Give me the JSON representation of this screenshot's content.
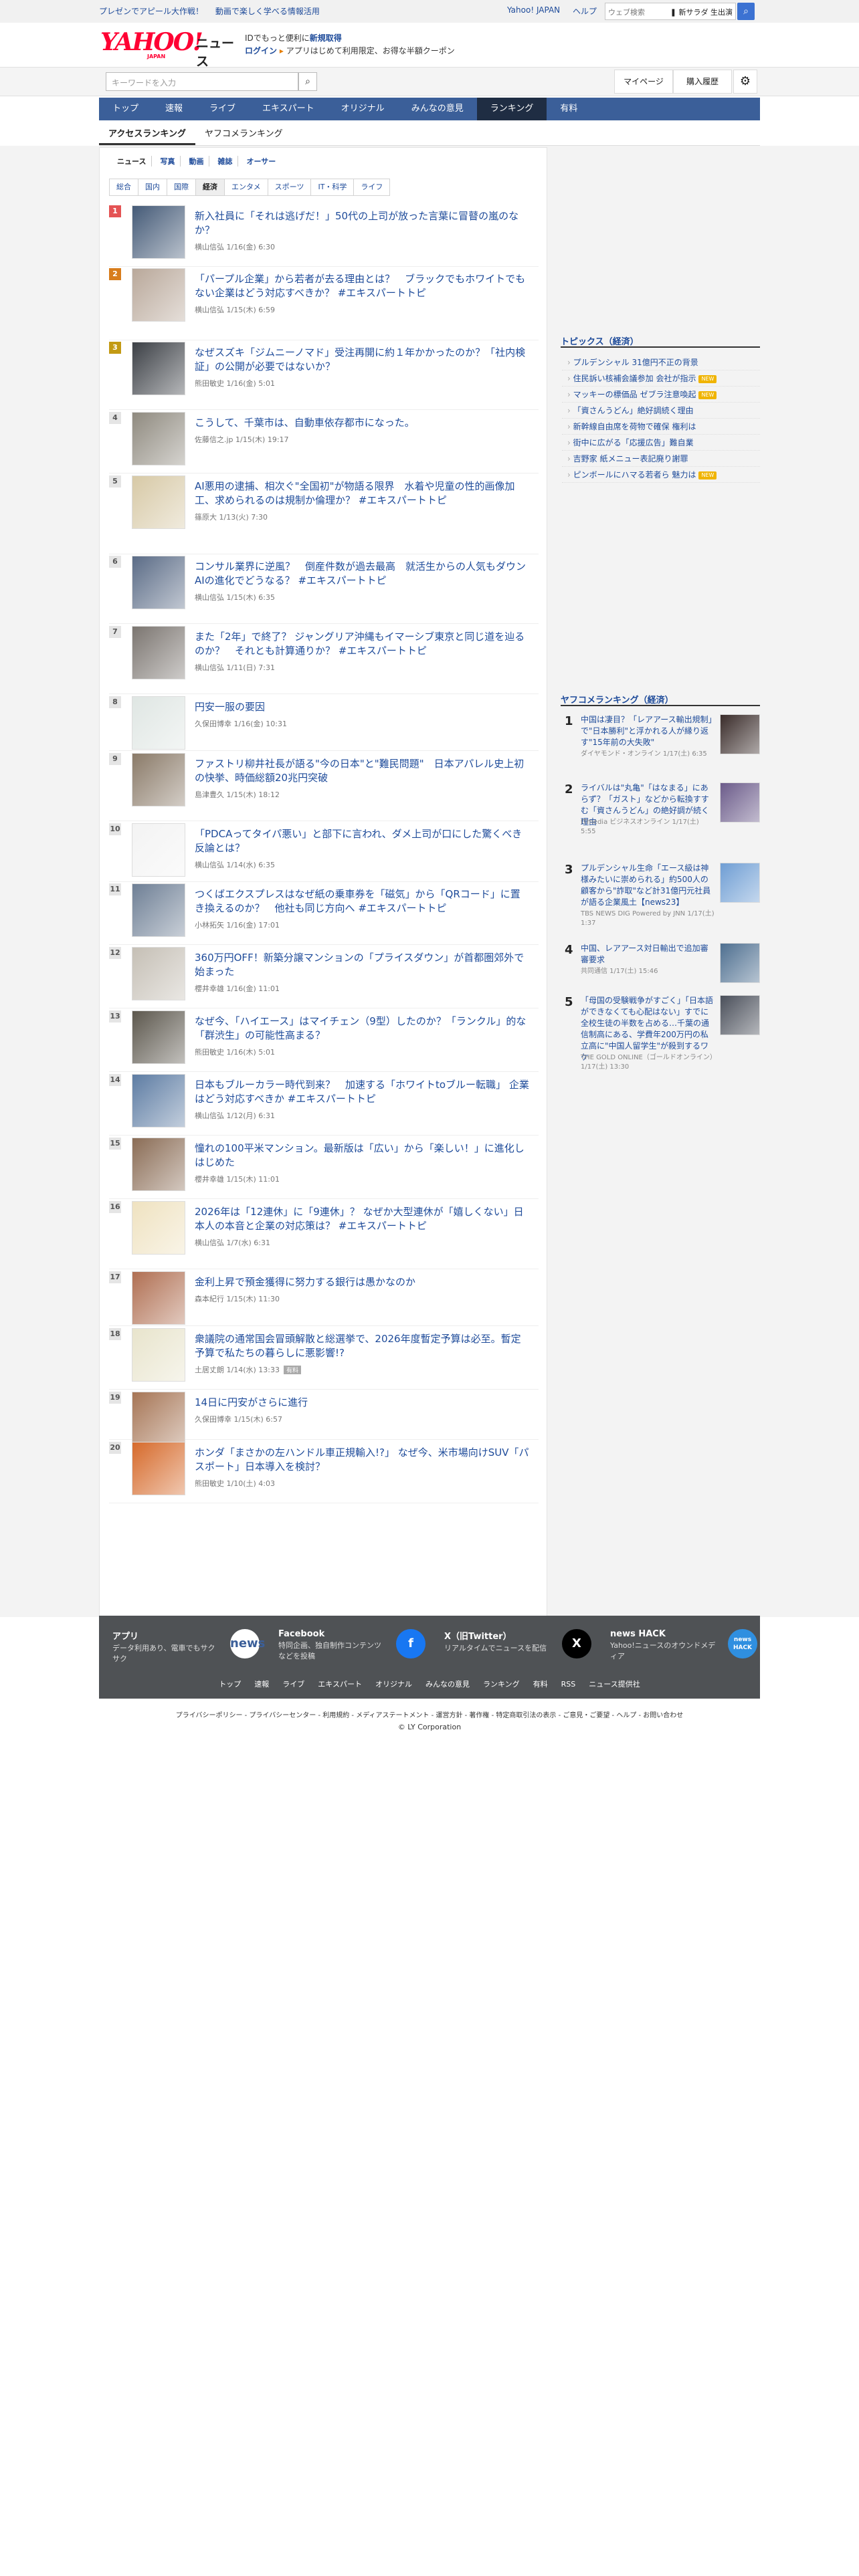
{
  "promo": {
    "left": "プレゼンでアピール大作戦！",
    "right": "動画で楽しく学べる情報活用"
  },
  "util": {
    "yahoo": "Yahoo! JAPAN",
    "help": "ヘルプ",
    "search_placeholder": "ウェブ検索",
    "search_suggest": "❚ 新サラダ 生出演"
  },
  "logo": {
    "yahoo": "YAHOO!",
    "japan": "JAPAN",
    "news": "ニュース"
  },
  "login": {
    "line1": "IDでもっと便利に",
    "line1_link": "新規取得",
    "login": "ログイン",
    "line2": "アプリはじめて利用限定、お得な半額クーポン"
  },
  "search": {
    "placeholder": "キーワードを入力",
    "mypage": "マイページ",
    "history": "購入履歴"
  },
  "nav": [
    "トップ",
    "速報",
    "ライブ",
    "エキスパート",
    "オリジナル",
    "みんなの意見",
    "ランキング",
    "有料"
  ],
  "nav_active": "ランキング",
  "subnav": [
    "アクセスランキング",
    "ヤフコメランキング"
  ],
  "categories": [
    "ニュース",
    "写真",
    "動画",
    "雑誌",
    "オーサー"
  ],
  "tabs": [
    "総合",
    "国内",
    "国際",
    "経済",
    "エンタメ",
    "スポーツ",
    "IT・科学",
    "ライフ"
  ],
  "tab_active": "経済",
  "articles": [
    {
      "rank": "1",
      "title": "新入社員に「それは逃げだ！」50代の上司が放った言葉に冒瞽の嵐のなか？",
      "source": "横山信弘",
      "date": "1/16(金) 6:30"
    },
    {
      "rank": "2",
      "title": "「パープル企業」から若者が去る理由とは？　ブラックでもホワイトでもない企業はどう対応すべきか？ #エキスパートトピ",
      "source": "横山信弘",
      "date": "1/15(木) 6:59"
    },
    {
      "rank": "3",
      "title": "なぜスズキ「ジムニーノマド」受注再開に約１年かかったのか？「社内検証」の公開が必要ではないか？",
      "source": "熊田敏史",
      "date": "1/16(金) 5:01"
    },
    {
      "rank": "4",
      "title": "こうして、千葉市は、自動車依存都市になった。",
      "source": "佐藤信之.jp",
      "date": "1/15(木) 19:17"
    },
    {
      "rank": "5",
      "title": "AI悪用の逮捕、相次ぐ\"全国初\"が物語る限界　水着や児童の性的画像加工、求められるのは規制か倫理か？ #エキスパートトピ",
      "source": "篠原大",
      "date": "1/13(火) 7:30"
    },
    {
      "rank": "6",
      "title": "コンサル業界に逆風？　倒産件数が過去最高　就活生からの人気もダウン AIの進化でどうなる？ #エキスパートトピ",
      "source": "横山信弘",
      "date": "1/15(木) 6:35"
    },
    {
      "rank": "7",
      "title": "また「2年」で終了？ ジャングリア沖縄もイマーシブ東京と同じ道を辿るのか？　それとも計算通りか？ #エキスパートトピ",
      "source": "横山信弘",
      "date": "1/11(日) 7:31"
    },
    {
      "rank": "8",
      "title": "円安一服の要因",
      "source": "久保田博幸",
      "date": "1/16(金) 10:31"
    },
    {
      "rank": "9",
      "title": "ファストリ柳井社長が語る\"今の日本\"と\"難民問題\"　日本アパレル史上初の快挙、時価総額20兆円突破",
      "source": "島津豊久",
      "date": "1/15(木) 18:12"
    },
    {
      "rank": "10",
      "title": "「PDCAってタイパ悪い」と部下に言われ、ダメ上司が口にした驚くべき反論とは？",
      "source": "横山信弘",
      "date": "1/14(水) 6:35"
    },
    {
      "rank": "11",
      "title": "つくばエクスプレスはなぜ紙の乗車券を「磁気」から「QRコード」に置き換えるのか？　他社も同じ方向へ #エキスパートトピ",
      "source": "小林拓矢",
      "date": "1/16(金) 17:01"
    },
    {
      "rank": "12",
      "title": "360万円OFF！新築分譲マンションの「プライスダウン」が首都圏郊外で始まった",
      "source": "櫻井幸雄",
      "date": "1/16(金) 11:01"
    },
    {
      "rank": "13",
      "title": "なぜ今、「ハイエース」はマイチェン（9型）したのか？「ランクル」的な「群渋生」の可能性高まる？",
      "source": "熊田敏史",
      "date": "1/16(木) 5:01"
    },
    {
      "rank": "14",
      "title": "日本もブルーカラー時代到来？　加速する「ホワイトtoブルー転職」 企業はどう対応すべきか #エキスパートトピ",
      "source": "横山信弘",
      "date": "1/12(月) 6:31"
    },
    {
      "rank": "15",
      "title": "憧れの100平米マンション。最新版は「広い」から「楽しい！」に進化しはじめた",
      "source": "櫻井幸雄",
      "date": "1/15(木) 11:01"
    },
    {
      "rank": "16",
      "title": "2026年は「12連休」に「9連休」？ なぜか大型連休が「嬉しくない」日本人の本音と企業の対応策は？ #エキスパートトピ",
      "source": "横山信弘",
      "date": "1/7(水) 6:31"
    },
    {
      "rank": "17",
      "title": "金利上昇で預金獲得に努力する銀行は愚かなのか",
      "source": "森本紀行",
      "date": "1/15(木) 11:30"
    },
    {
      "rank": "18",
      "title": "衆議院の通常国会冒頭解散と総選挙で、2026年度暫定予算は必至。暫定予算で私たちの暮らしに悪影響!?",
      "source": "土居丈朗",
      "date": "1/14(水) 13:33",
      "badge": "有料"
    },
    {
      "rank": "19",
      "title": "14日に円安がさらに進行",
      "source": "久保田博幸",
      "date": "1/15(木) 6:57"
    },
    {
      "rank": "20",
      "title": "ホンダ「まさかの左ハンドル車正規輸入!?」 なぜ今、米市場向けSUV「パスポート」日本導入を検討？",
      "source": "熊田敏史",
      "date": "1/10(土) 4:03"
    }
  ],
  "topics": {
    "heading": "トピックス（経済）",
    "items": [
      {
        "text": "プルデンシャル 31億円不正の背景",
        "new": ""
      },
      {
        "text": "住民訴い核補会議参加 会社が指示",
        "new": "NEW"
      },
      {
        "text": "マッキーの標価品 ゼブラ注意喚起",
        "new": "NEW"
      },
      {
        "text": "「資さんうどん」絶好調続く理由",
        "new": ""
      },
      {
        "text": "新幹線自由席を荷物で確保 権利は",
        "new": ""
      },
      {
        "text": "街中に広がる「応援広告」難自業",
        "new": ""
      },
      {
        "text": "吉野家 紙メニュー表記廃り謝罪",
        "new": ""
      },
      {
        "text": "ピンボールにハマる若者ら 魅力は",
        "new": "NEW"
      }
    ]
  },
  "eco_ranking": {
    "heading": "ヤフコメランキング（経済）",
    "items": [
      {
        "rank": "1",
        "title": "中国は凄目？「レアアース輸出規制」で\"日本勝利\"と浮かれる人が縁り返す\"15年前の大失敗\"",
        "meta": "ダイヤモンド・オンライン 1/17(土) 6:35"
      },
      {
        "rank": "2",
        "title": "ライバルは\"丸亀\"「はなまる」にあらず？「ガスト」などから転換すすむ「資さんうどん」の絶好調が続く理由",
        "meta": "ITmedia ビジネスオンライン 1/17(土) 5:55"
      },
      {
        "rank": "3",
        "title": "プルデンシャル生命「エース級は神様みたいに崇められる」約500人の顧客から\"詐取\"など計31億円元社員が語る企業風土【news23】",
        "meta": "TBS NEWS DIG Powered by JNN 1/17(土) 1:37"
      },
      {
        "rank": "4",
        "title": "中国、レアアース対日輸出で追加審審要求",
        "meta": "共同通信 1/17(土) 15:46"
      },
      {
        "rank": "5",
        "title": "「母国の受験戦争がすごく」「日本語ができなくても心配はない」すでに全校生徒の半数を占める…千葉の通信制高にある、学費年200万円の私立高に\"中国人留学生\"が殺到するワケ",
        "meta": "THE GOLD ONLINE（ゴールドオンライン）1/17(土) 13:30"
      }
    ]
  },
  "footer": {
    "cols": [
      {
        "title": "アプリ",
        "desc": "データ利用あり、電車でもサクサク",
        "icon": "news"
      },
      {
        "title": "Facebook",
        "desc": "特同企画、独自制作コンテンツなどを投稿",
        "icon": "f"
      },
      {
        "title": "X（旧Twitter）",
        "desc": "リアルタイムでニュースを配信",
        "icon": "X"
      },
      {
        "title": "news HACK",
        "desc": "Yahoo!ニュースのオウンドメディア",
        "icon": "news HACK"
      }
    ],
    "links": [
      "トップ",
      "速報",
      "ライブ",
      "エキスパート",
      "オリジナル",
      "みんなの意見",
      "ランキング",
      "有料",
      "RSS",
      "ニュース提供社"
    ],
    "bottom": "プライバシーポリシー - プライバシーセンター - 利用規約 - メディアステートメント - 運営方針 - 著作権 - 特定商取引法の表示 - ご意見・ご要望 - ヘルプ - お問い合わせ",
    "copyright": "© LY Corporation"
  }
}
